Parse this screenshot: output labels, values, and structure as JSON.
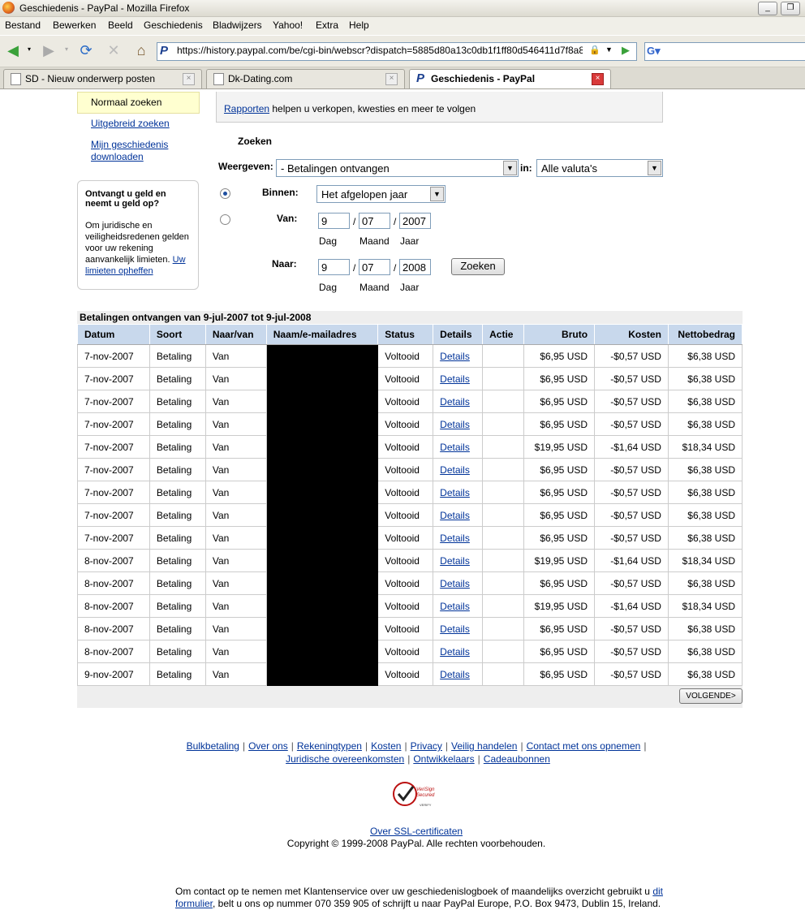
{
  "window": {
    "title": "Geschiedenis - PayPal - Mozilla Firefox"
  },
  "menu": [
    "Bestand",
    "Bewerken",
    "Beeld",
    "Geschiedenis",
    "Bladwijzers",
    "Yahoo!",
    "Extra",
    "Help"
  ],
  "url": "https://history.paypal.com/be/cgi-bin/webscr?dispatch=5885d80a13c0db1f1ff80d546411d7f8a8",
  "tabs": [
    {
      "label": "SD - Nieuw onderwerp posten",
      "active": false
    },
    {
      "label": "Dk-Dating.com",
      "active": false
    },
    {
      "label": "Geschiedenis - PayPal",
      "active": true
    }
  ],
  "sidebar": {
    "normal_search": "Normaal zoeken",
    "advanced_search": "Uitgebreid zoeken",
    "download_history": "Mijn geschiedenis downloaden",
    "info_title": "Ontvangt u geld en neemt u geld op?",
    "info_text": "Om juridische en veiligheidsredenen gelden voor uw rekening aanvankelijk limieten.",
    "info_link": "Uw limieten opheffen"
  },
  "reports": {
    "link": "Rapporten",
    "text": " helpen u verkopen, kwesties en meer te volgen"
  },
  "search": {
    "heading": "Zoeken",
    "show_label": "Weergeven:",
    "show_value": "- Betalingen ontvangen",
    "in_label": "in:",
    "currency_value": "Alle valuta's",
    "within_label": "Binnen:",
    "within_value": "Het afgelopen jaar",
    "from_label": "Van:",
    "from_day": "9",
    "from_month": "07",
    "from_year": "2007",
    "to_label": "Naar:",
    "to_day": "9",
    "to_month": "07",
    "to_year": "2008",
    "day_label": "Dag",
    "month_label": "Maand",
    "year_label": "Jaar",
    "slash": "/",
    "search_button": "Zoeken"
  },
  "results": {
    "caption": "Betalingen ontvangen van 9-jul-2007 tot 9-jul-2008",
    "headers": [
      "Datum",
      "Soort",
      "Naar/van",
      "Naam/e-mailadres",
      "Status",
      "Details",
      "Actie",
      "Bruto",
      "Kosten",
      "Nettobedrag"
    ],
    "rows": [
      [
        "7-nov-2007",
        "Betaling",
        "Van",
        "",
        "Voltooid",
        "Details",
        "",
        "$6,95 USD",
        "-$0,57 USD",
        "$6,38 USD"
      ],
      [
        "7-nov-2007",
        "Betaling",
        "Van",
        "",
        "Voltooid",
        "Details",
        "",
        "$6,95 USD",
        "-$0,57 USD",
        "$6,38 USD"
      ],
      [
        "7-nov-2007",
        "Betaling",
        "Van",
        "",
        "Voltooid",
        "Details",
        "",
        "$6,95 USD",
        "-$0,57 USD",
        "$6,38 USD"
      ],
      [
        "7-nov-2007",
        "Betaling",
        "Van",
        "",
        "Voltooid",
        "Details",
        "",
        "$6,95 USD",
        "-$0,57 USD",
        "$6,38 USD"
      ],
      [
        "7-nov-2007",
        "Betaling",
        "Van",
        "",
        "Voltooid",
        "Details",
        "",
        "$19,95 USD",
        "-$1,64 USD",
        "$18,34 USD"
      ],
      [
        "7-nov-2007",
        "Betaling",
        "Van",
        "",
        "Voltooid",
        "Details",
        "",
        "$6,95 USD",
        "-$0,57 USD",
        "$6,38 USD"
      ],
      [
        "7-nov-2007",
        "Betaling",
        "Van",
        "",
        "Voltooid",
        "Details",
        "",
        "$6,95 USD",
        "-$0,57 USD",
        "$6,38 USD"
      ],
      [
        "7-nov-2007",
        "Betaling",
        "Van",
        "",
        "Voltooid",
        "Details",
        "",
        "$6,95 USD",
        "-$0,57 USD",
        "$6,38 USD"
      ],
      [
        "7-nov-2007",
        "Betaling",
        "Van",
        "",
        "Voltooid",
        "Details",
        "",
        "$6,95 USD",
        "-$0,57 USD",
        "$6,38 USD"
      ],
      [
        "8-nov-2007",
        "Betaling",
        "Van",
        "",
        "Voltooid",
        "Details",
        "",
        "$19,95 USD",
        "-$1,64 USD",
        "$18,34 USD"
      ],
      [
        "8-nov-2007",
        "Betaling",
        "Van",
        "",
        "Voltooid",
        "Details",
        "",
        "$6,95 USD",
        "-$0,57 USD",
        "$6,38 USD"
      ],
      [
        "8-nov-2007",
        "Betaling",
        "Van",
        "",
        "Voltooid",
        "Details",
        "",
        "$19,95 USD",
        "-$1,64 USD",
        "$18,34 USD"
      ],
      [
        "8-nov-2007",
        "Betaling",
        "Van",
        "",
        "Voltooid",
        "Details",
        "",
        "$6,95 USD",
        "-$0,57 USD",
        "$6,38 USD"
      ],
      [
        "8-nov-2007",
        "Betaling",
        "Van",
        "",
        "Voltooid",
        "Details",
        "",
        "$6,95 USD",
        "-$0,57 USD",
        "$6,38 USD"
      ],
      [
        "9-nov-2007",
        "Betaling",
        "Van",
        "",
        "Voltooid",
        "Details",
        "",
        "$6,95 USD",
        "-$0,57 USD",
        "$6,38 USD"
      ]
    ],
    "next_button": "VOLGENDE>"
  },
  "footer": {
    "links_line1": [
      "Bulkbetaling",
      "Over ons",
      "Rekeningtypen",
      "Kosten",
      "Privacy",
      "Veilig handelen",
      "Contact met ons opnemen"
    ],
    "links_line2": [
      "Juridische overeenkomsten",
      "Ontwikkelaars",
      "Cadeaubonnen"
    ],
    "verisign_line1": "VeriSign",
    "verisign_line2": "Secured",
    "verisign_line3": "VERIFY",
    "ssl_link": "Over SSL-certificaten",
    "copyright": "Copyright © 1999-2008 PayPal. Alle rechten voorbehouden.",
    "contact_text_1": "Om contact op te nemen met Klantenservice over uw geschiedenislogboek of maandelijks overzicht gebruikt u ",
    "contact_link_1": "dit",
    "contact_link_2": "formulier",
    "contact_text_2": ", belt u ons op nummer 070 359 905 of schrijft u naar PayPal Europe, P.O. Box 9473, Dublin 15, Ireland."
  }
}
